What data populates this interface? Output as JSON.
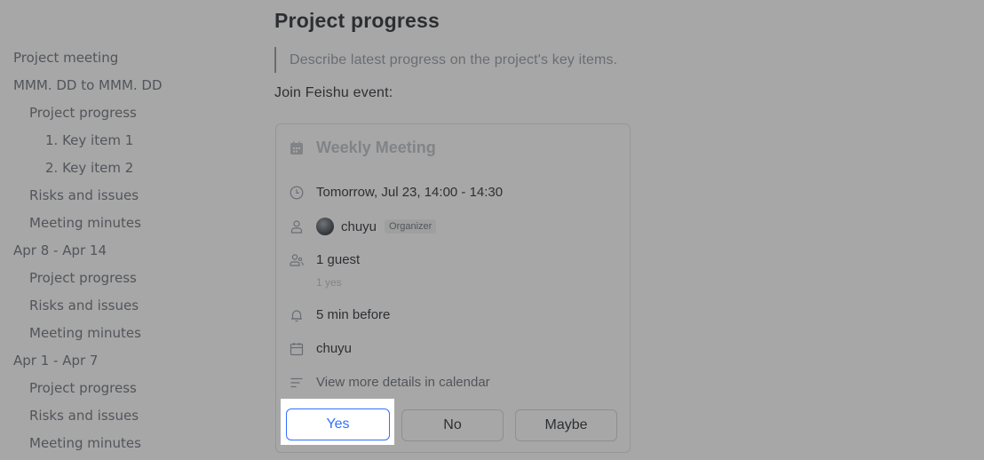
{
  "sidebar": {
    "items": [
      {
        "label": "Project meeting",
        "level": 1
      },
      {
        "label": "MMM. DD to MMM. DD",
        "level": 1
      },
      {
        "label": "Project progress",
        "level": 2
      },
      {
        "label": "1. Key item 1",
        "level": 3
      },
      {
        "label": "2. Key item 2",
        "level": 3
      },
      {
        "label": "Risks and issues",
        "level": 2
      },
      {
        "label": "Meeting minutes",
        "level": 2
      },
      {
        "label": "Apr 8 - Apr 14",
        "level": 1
      },
      {
        "label": "Project progress",
        "level": 2
      },
      {
        "label": "Risks and issues",
        "level": 2
      },
      {
        "label": "Meeting minutes",
        "level": 2
      },
      {
        "label": "Apr 1 - Apr 7",
        "level": 1
      },
      {
        "label": "Project progress",
        "level": 2
      },
      {
        "label": "Risks and issues",
        "level": 2
      },
      {
        "label": "Meeting minutes",
        "level": 2
      }
    ]
  },
  "main": {
    "title": "Project progress",
    "quote": "Describe latest progress on the project's key items.",
    "join_label": "Join Feishu event:"
  },
  "event": {
    "title": "Weekly Meeting",
    "time": "Tomorrow, Jul 23, 14:00 - 14:30",
    "organizer_name": "chuyu",
    "organizer_badge": "Organizer",
    "guests": "1 guest",
    "guests_sub": "1 yes",
    "reminder": "5 min before",
    "calendar": "chuyu",
    "details_link": "View more details in calendar",
    "buttons": {
      "yes": "Yes",
      "no": "No",
      "maybe": "Maybe"
    },
    "accent": "#3370ff"
  }
}
